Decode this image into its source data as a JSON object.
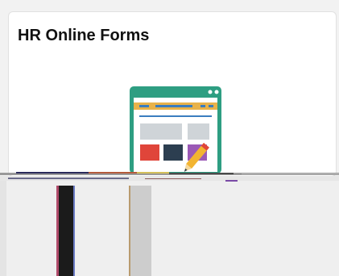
{
  "tile": {
    "title": "HR Online Forms",
    "icon": "online-form-illustration-icon"
  },
  "colors": {
    "window_frame": "#2e9e82",
    "window_header": "#2e9e82",
    "yellow_bar": "#e8b24a",
    "blue_bar": "#3b7dbf",
    "light_gray_block": "#cfd4d8",
    "red_block": "#e0453a",
    "dark_block": "#2c3e50",
    "purple_block": "#9b59b6",
    "pencil_body": "#f2b431",
    "pencil_tip": "#f6d89a",
    "pencil_eraser": "#e0453a"
  }
}
